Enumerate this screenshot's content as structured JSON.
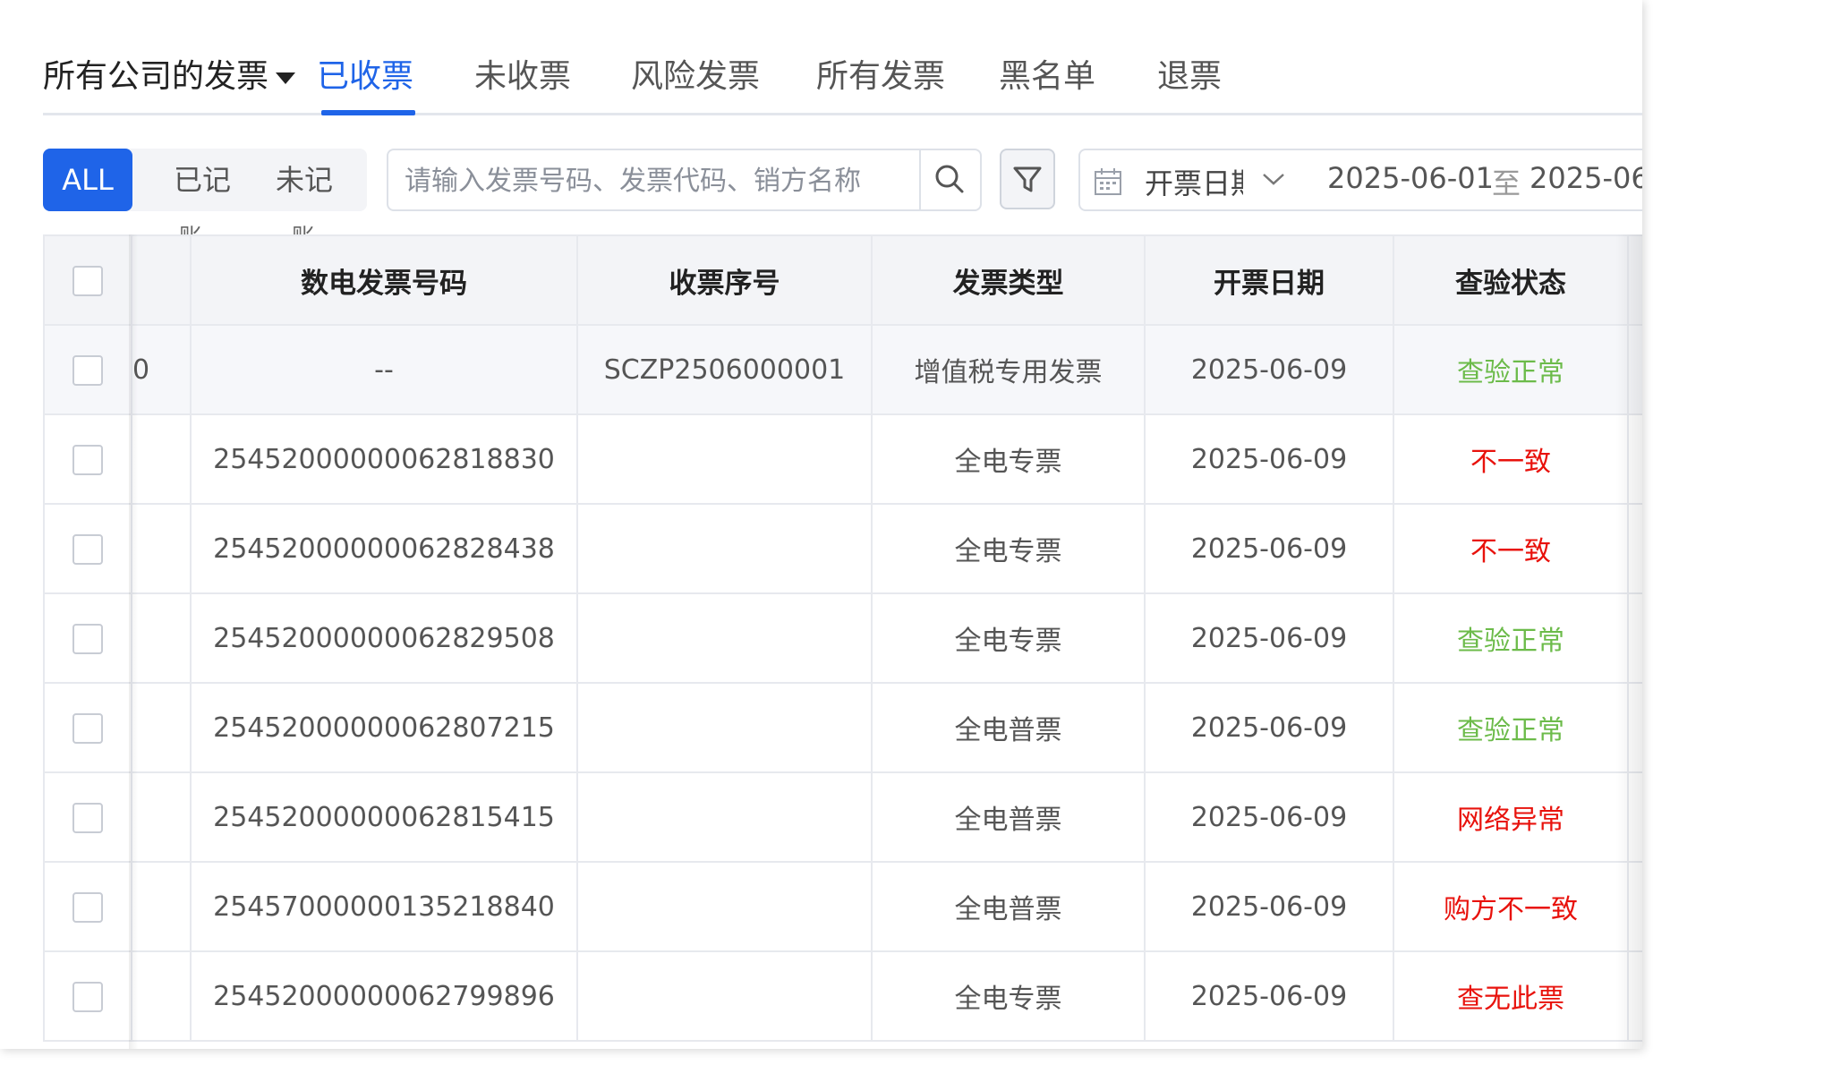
{
  "header": {
    "company_selector": "所有公司的发票",
    "tabs": [
      {
        "label": "已收票",
        "active": true
      },
      {
        "label": "未收票",
        "active": false
      },
      {
        "label": "风险发票",
        "active": false
      },
      {
        "label": "所有发票",
        "active": false
      },
      {
        "label": "黑名单",
        "active": false
      },
      {
        "label": "退票",
        "active": false
      }
    ],
    "accent_color": "#1f64e8"
  },
  "filters": {
    "segments": [
      {
        "label": "ALL",
        "sub": "",
        "selected": true
      },
      {
        "label": "已记",
        "sub": "账",
        "selected": false
      },
      {
        "label": "未记",
        "sub": "账",
        "selected": false
      }
    ],
    "search": {
      "placeholder": "请输入发票号码、发票代码、销方名称",
      "value": "",
      "button_icon": "search-icon"
    },
    "filter_icon": "funnel-icon",
    "date": {
      "type_label": "开票日期",
      "start": "2025-06-01",
      "separator": "至",
      "end": "2025-06-",
      "icon": "calendar-icon"
    }
  },
  "table": {
    "columns": [
      "数电发票号码",
      "收票序号",
      "发票类型",
      "开票日期",
      "查验状态"
    ],
    "rows": [
      {
        "hidden": "0",
        "number": "--",
        "seq": "SCZP2506000001",
        "type": "增值税专用发票",
        "date": "2025-06-09",
        "status": "查验正常",
        "status_color": "#6cbb4a"
      },
      {
        "hidden": "",
        "number": "25452000000062818830",
        "seq": "",
        "type": "全电专票",
        "date": "2025-06-09",
        "status": "不一致",
        "status_color": "#e8120c"
      },
      {
        "hidden": "",
        "number": "25452000000062828438",
        "seq": "",
        "type": "全电专票",
        "date": "2025-06-09",
        "status": "不一致",
        "status_color": "#e8120c"
      },
      {
        "hidden": "",
        "number": "25452000000062829508",
        "seq": "",
        "type": "全电专票",
        "date": "2025-06-09",
        "status": "查验正常",
        "status_color": "#6cbb4a"
      },
      {
        "hidden": "",
        "number": "25452000000062807215",
        "seq": "",
        "type": "全电普票",
        "date": "2025-06-09",
        "status": "查验正常",
        "status_color": "#6cbb4a"
      },
      {
        "hidden": "",
        "number": "25452000000062815415",
        "seq": "",
        "type": "全电普票",
        "date": "2025-06-09",
        "status": "网络异常",
        "status_color": "#e8120c"
      },
      {
        "hidden": "",
        "number": "25457000000135218840",
        "seq": "",
        "type": "全电普票",
        "date": "2025-06-09",
        "status": "购方不一致",
        "status_color": "#e8120c"
      },
      {
        "hidden": "",
        "number": "25452000000062799896",
        "seq": "",
        "type": "全电专票",
        "date": "2025-06-09",
        "status": "查无此票",
        "status_color": "#e8120c"
      }
    ]
  }
}
